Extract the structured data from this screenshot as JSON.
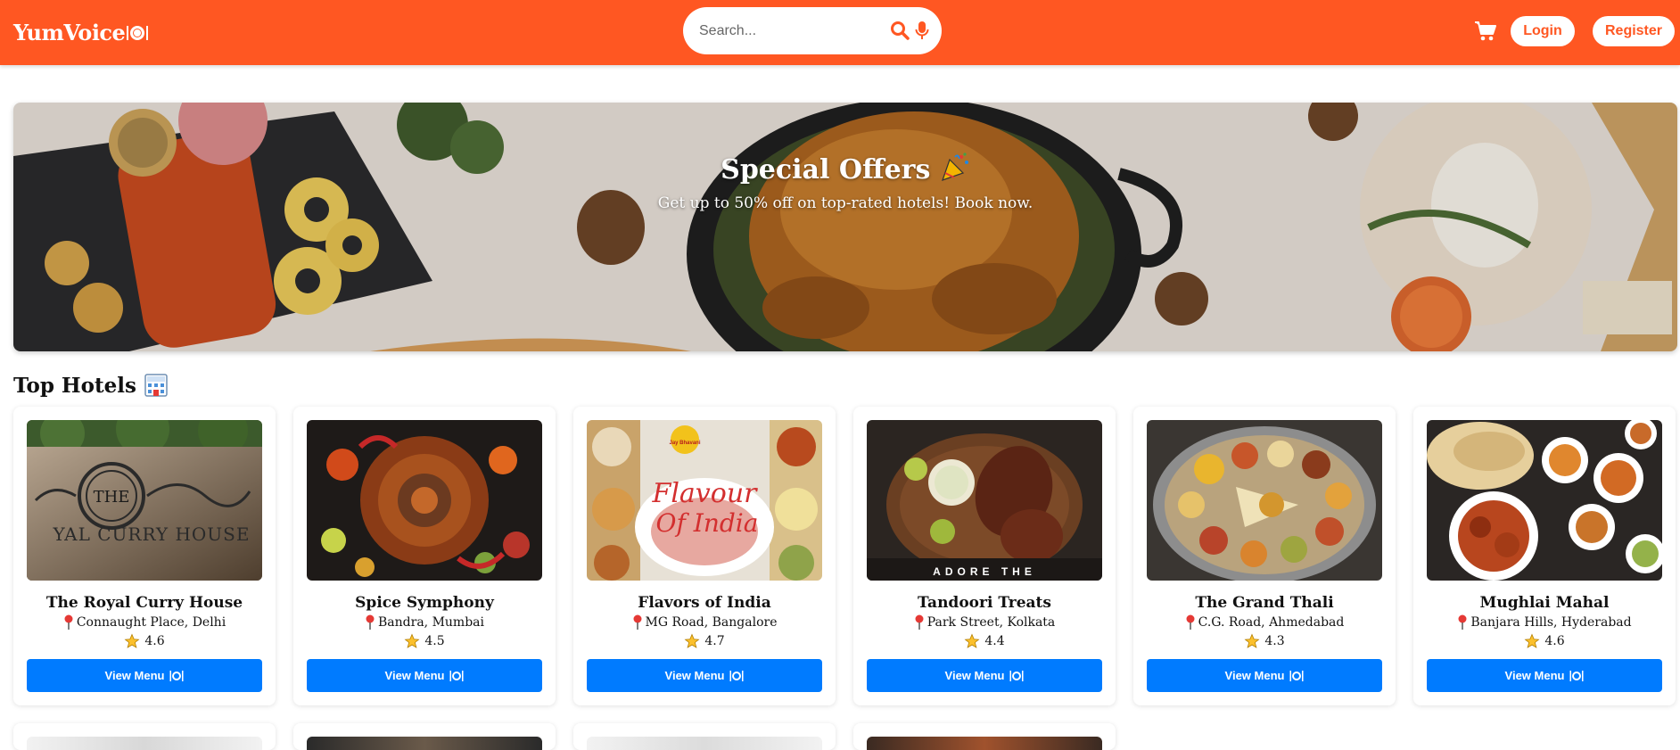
{
  "navbar": {
    "brand": "YumVoice",
    "search_placeholder": "Search...",
    "login_label": "Login",
    "register_label": "Register",
    "colors": {
      "primary": "#ff5722",
      "button": "#007bff"
    }
  },
  "banner": {
    "title": "Special Offers",
    "subtitle": "Get up to 50% off on top-rated hotels! Book now."
  },
  "section": {
    "title": "Top Hotels"
  },
  "hotels": [
    {
      "name": "The Royal Curry House",
      "location": "Connaught Place, Delhi",
      "rating": "4.6",
      "button": "View Menu"
    },
    {
      "name": "Spice Symphony",
      "location": "Bandra, Mumbai",
      "rating": "4.5",
      "button": "View Menu"
    },
    {
      "name": "Flavors of India",
      "location": "MG Road, Bangalore",
      "rating": "4.7",
      "button": "View Menu"
    },
    {
      "name": "Tandoori Treats",
      "location": "Park Street, Kolkata",
      "rating": "4.4",
      "button": "View Menu"
    },
    {
      "name": "The Grand Thali",
      "location": "C.G. Road, Ahmedabad",
      "rating": "4.3",
      "button": "View Menu"
    },
    {
      "name": "Mughlai Mahal",
      "location": "Banjara Hills, Hyderabad",
      "rating": "4.6",
      "button": "View Menu"
    }
  ],
  "thumb_text": {
    "royal_sign_top": "THE",
    "royal_sign_bottom": "YAL CURRY HOUSE",
    "flavour_line1": "Flavour",
    "flavour_line2": "Of India",
    "flavour_badge": "Jay Bhavani",
    "tandoori_caption": "ADORE THE"
  }
}
